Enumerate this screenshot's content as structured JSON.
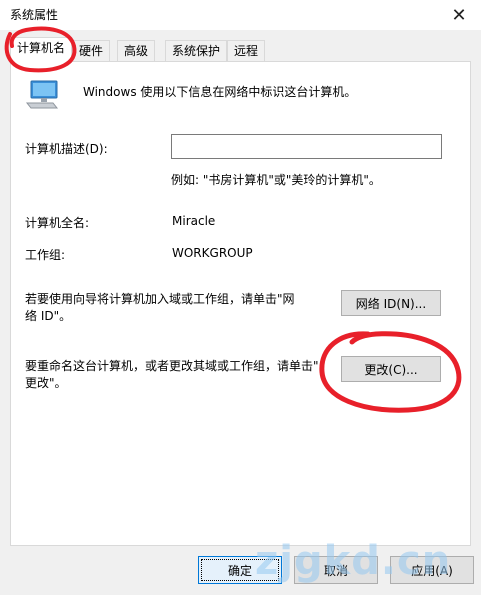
{
  "window": {
    "title": "系统属性",
    "close_icon": "close-icon"
  },
  "tabs": [
    {
      "label": "计算机名",
      "active": true
    },
    {
      "label": "硬件"
    },
    {
      "label": "高级"
    },
    {
      "label": "系统保护"
    },
    {
      "label": "远程"
    }
  ],
  "panel": {
    "intro": "Windows 使用以下信息在网络中标识这台计算机。",
    "description_label": "计算机描述(D):",
    "description_value": "",
    "example": "例如: \"书房计算机\"或\"美玲的计算机\"。",
    "fullname_label": "计算机全名:",
    "fullname_value": "Miracle",
    "workgroup_label": "工作组:",
    "workgroup_value": "WORKGROUP",
    "network_text_1": "若要使用向导将计算机加入域或工作组，请单击\"网",
    "network_text_2": "络 ID\"。",
    "network_button": "网络 ID(N)...",
    "rename_text_1": "要重命名这台计算机，或者更改其域或工作组，请单击\"",
    "rename_text_2": "更改\"。",
    "change_button": "更改(C)..."
  },
  "footer": {
    "ok": "确定",
    "cancel": "取消",
    "apply": "应用(A)"
  },
  "watermark": "zjgkd.cn",
  "colors": {
    "annotation_red": "#e8202a",
    "focus_blue": "#0078d7"
  }
}
